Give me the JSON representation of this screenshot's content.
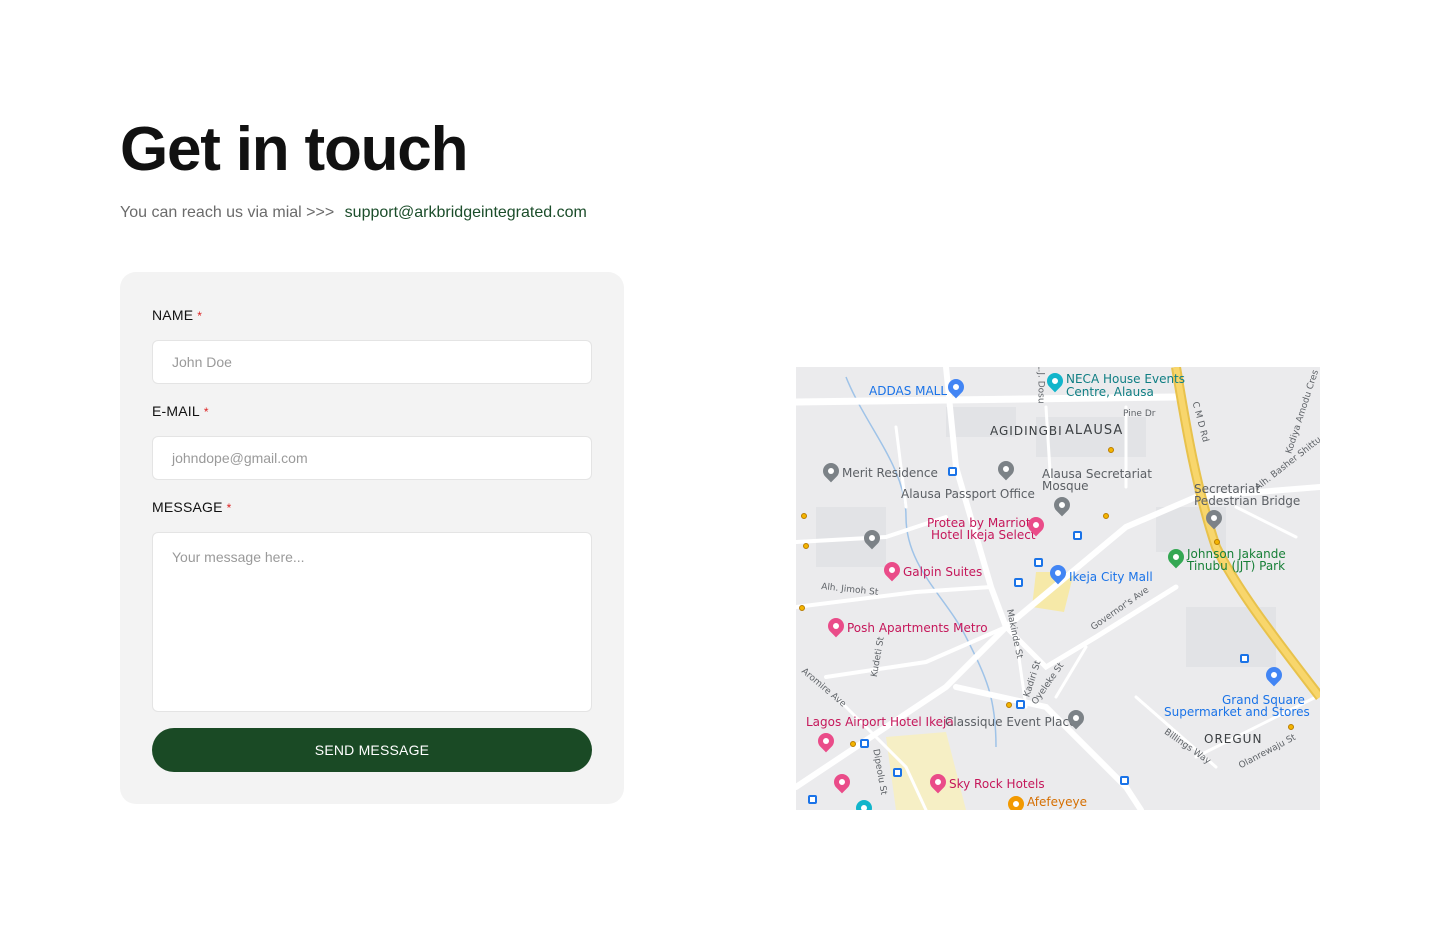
{
  "header": {
    "title": "Get in touch",
    "reach_text": "You can reach us via mial >>>",
    "email": "support@arkbridgeintegrated.com"
  },
  "form": {
    "name_label": "NAME",
    "email_label": "E-MAIL",
    "message_label": "MESSAGE",
    "required_mark": "*",
    "name_placeholder": "John Doe",
    "email_placeholder": "johndope@gmail.com",
    "message_placeholder": "Your message here...",
    "submit_label": "SEND MESSAGE",
    "accent_color": "#1a4a25"
  },
  "map": {
    "areas": [
      "AGIDINGBI",
      "ALAUSA",
      "OREGUN"
    ],
    "pois": [
      {
        "label": "ADDAS MALL",
        "icon": "shopping-bag-icon"
      },
      {
        "label": "NECA House Events",
        "icon": "event-venue-icon"
      },
      {
        "label": "Centre, Alausa",
        "icon": ""
      },
      {
        "label": "Merit Residence",
        "icon": "place-pin-icon"
      },
      {
        "label": "Alausa Secretariat",
        "icon": "place-pin-icon"
      },
      {
        "label": "Mosque",
        "icon": ""
      },
      {
        "label": "Alausa Passport Office",
        "icon": ""
      },
      {
        "label": "Protea by Marriott",
        "icon": "hotel-icon"
      },
      {
        "label": "Hotel Ikeja Select",
        "icon": ""
      },
      {
        "label": "Galpin Suites",
        "icon": "hotel-icon"
      },
      {
        "label": "Ikeja City Mall",
        "icon": "shopping-bag-icon"
      },
      {
        "label": "Johnson Jakande",
        "icon": "park-icon"
      },
      {
        "label": "Tinubu (JJT) Park",
        "icon": ""
      },
      {
        "label": "Secretariat",
        "icon": "place-pin-icon"
      },
      {
        "label": "Pedestrian Bridge",
        "icon": ""
      },
      {
        "label": "Posh Apartments Metro",
        "icon": "hotel-icon"
      },
      {
        "label": "Lagos Airport Hotel Ikeja",
        "icon": "hotel-icon"
      },
      {
        "label": "Classique Event Place",
        "icon": "place-pin-icon"
      },
      {
        "label": "Grand Square",
        "icon": "shopping-cart-icon"
      },
      {
        "label": "Supermarket and Stores",
        "icon": ""
      },
      {
        "label": "Sky Rock Hotels",
        "icon": "hotel-icon"
      },
      {
        "label": "Afefeyeye",
        "icon": "restaurant-icon"
      }
    ],
    "streets": [
      "Pine Dr",
      "C M D Rd",
      "Alh. Jimoh St",
      "Kudeti St",
      "Aromire Ave",
      "Makinde St",
      "Kadiri St",
      "Oyeleke St",
      "Governor's Ave",
      "Billings Way",
      "Olanrewaju St",
      "Dipeolu St",
      "Alh. Basher Shittu",
      "Kodiya Amodu Cres",
      "L.J. Dosu"
    ]
  }
}
